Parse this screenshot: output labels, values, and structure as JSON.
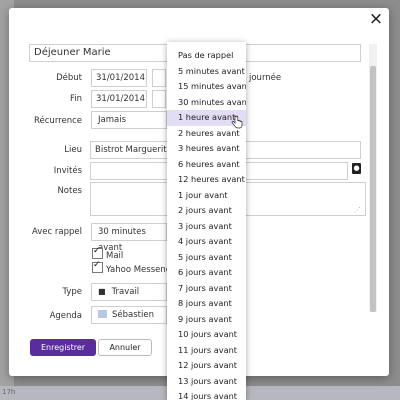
{
  "backdrop": {
    "bottom_label": "17h"
  },
  "dialog": {
    "close_glyph": "×",
    "title_value": "Déjeuner Marie",
    "start": {
      "label": "Début",
      "date": "31/01/2014",
      "all_day_text": "journée"
    },
    "end": {
      "label": "Fin",
      "date": "31/01/2014"
    },
    "recurrence": {
      "label": "Récurrence",
      "value": "Jamais"
    },
    "location": {
      "label": "Lieu",
      "value": "Bistrot Marguerite"
    },
    "guests": {
      "label": "Invités",
      "value": ""
    },
    "notes": {
      "label": "Notes",
      "value": ""
    },
    "reminder": {
      "label": "Avec rappel",
      "value": "30 minutes avant"
    },
    "notify": [
      {
        "label": "Mail",
        "checked": true
      },
      {
        "label": "Yahoo Messenger",
        "checked": true
      }
    ],
    "type": {
      "label": "Type",
      "value": "Travail"
    },
    "calendar": {
      "label": "Agenda",
      "value": "Sébastien",
      "color": "#b9c6e4"
    },
    "save_label": "Enregistrer",
    "cancel_label": "Annuler",
    "accent_color": "#5b2ca0"
  },
  "reminder_dropdown": {
    "highlighted_index": 4,
    "options": [
      "Pas de rappel",
      "5 minutes avant",
      "15 minutes avant",
      "30 minutes avant",
      "1 heure avant",
      "2 heures avant",
      "3 heures avant",
      "6 heures avant",
      "12 heures avant",
      "1 jour avant",
      "2 jours avant",
      "3 jours avant",
      "4 jours avant",
      "5 jours avant",
      "6 jours avant",
      "7 jours avant",
      "8 jours avant",
      "9 jours avant",
      "10 jours avant",
      "11 jours avant",
      "12 jours avant",
      "13 jours avant",
      "14 jours avant"
    ]
  }
}
